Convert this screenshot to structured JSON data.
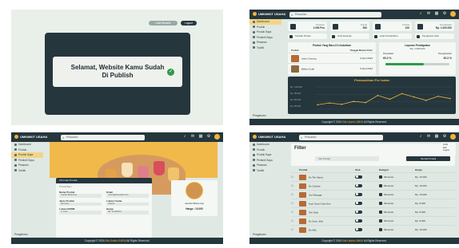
{
  "publish": {
    "pill_preview": "Lihat Website",
    "pill_action": "Logout",
    "message": "Selamat, Website Kamu Sudah Di Publish",
    "icons": [
      "check-circle-icon"
    ]
  },
  "app": {
    "brand": "UMKMKIT USAHA",
    "search_placeholder": "Pencarian",
    "footer_prefix": "Copyright © 2024",
    "footer_brand": "Kita Usaha UMKM",
    "footer_suffix": "All Rights Reserved.",
    "sidebar": [
      "Dashboard",
      "Produk",
      "Produk Saya",
      "Pembeli Saya",
      "Pesanan",
      "Toolkit"
    ],
    "sidebar_bottom": "Pengaturan"
  },
  "dashboard": {
    "stats": [
      {
        "label": "Pesanan",
        "value": "1.000 Pcs"
      },
      {
        "label": "Terjual",
        "value": "500"
      },
      {
        "label": "Produk",
        "value": "100"
      },
      {
        "label": "Pendapatan",
        "value": "Rp. 1.000.000"
      }
    ],
    "chips": [
      "Tambah Produk",
      "Lihat Pesanan",
      "Lihat Produk Baru",
      "Pengaturan Toko"
    ],
    "table_title": "Produk Yang Baru Di Unduhkan",
    "table_headers": [
      "Produk",
      "Tanggal Masuk Order"
    ],
    "table_rows": [
      {
        "name": "Ayam Goreng",
        "date": "6 April 2024"
      },
      {
        "name": "Bakso Kuah",
        "date": "5 April 2024"
      }
    ],
    "target_title": "Laporan Pendapatan",
    "target_value": "Rp. 1.000.000",
    "target_labels": [
      "Penjualan",
      "Pengeluaran"
    ],
    "target_pcts": [
      "60.2 %",
      "20.3 %"
    ],
    "chart_title": "Pemasukkan Per bulan",
    "chart_ylabels": [
      "Rp. 1.000.000",
      "Rp. 750.000",
      "Rp. 500.000",
      "Rp. 250.000"
    ],
    "chart_data": {
      "type": "line",
      "title": "Pemasukkan Per bulan",
      "x": [
        1,
        2,
        3,
        4,
        5,
        6,
        7,
        8,
        9,
        10,
        11,
        12
      ],
      "series": [
        {
          "values": [
            20,
            28,
            22,
            35,
            30,
            62,
            45,
            70,
            55,
            40,
            58,
            48
          ]
        }
      ],
      "ylim": [
        0,
        100
      ]
    }
  },
  "detail": {
    "form_title": "Informasi Produk",
    "form_sub": "Produk Baru",
    "fields": [
      {
        "label": "Nama Produk",
        "value": "Jual Es Boba Cup"
      },
      {
        "label": "Email",
        "value": "umkm@kitausaha.com"
      },
      {
        "label": "Jenis Produk",
        "value": "Minuman"
      },
      {
        "label": "Lokasi Usaha",
        "value": "Jakarta"
      },
      {
        "label": "Lokasi KDNM",
        "value": "1-4 hari"
      },
      {
        "label": "Harga",
        "value": "Rp. 10.000/Pcs"
      }
    ],
    "card_name": "Jual Es Boba Cup",
    "card_price": "Harga : 10.000"
  },
  "products": {
    "filter_title": "Filter",
    "filter_placeholder": "Cari Produk",
    "filter_button": "Tambah Produk",
    "menu_items": [
      "Profil",
      "Edit",
      "Logout"
    ],
    "headers": [
      "Produk",
      "Stok",
      "Kategori",
      "Harga"
    ],
    "rows": [
      {
        "name": "Es Teh Manis",
        "category": "Minuman",
        "price": "Rp. 10.000"
      },
      {
        "name": "Es Cokelat",
        "category": "Minuman",
        "price": "Rp. 10.000"
      },
      {
        "name": "Jus Mangga",
        "category": "Minuman",
        "price": "Rp. 10.000"
      },
      {
        "name": "Kopi Susu Gula Aren",
        "category": "Minuman",
        "price": "Rp. 8.000"
      },
      {
        "name": "Teh Tarik",
        "category": "Minuman",
        "price": "Rp. 8.000"
      },
      {
        "name": "Es Susu Jelly",
        "category": "Minuman",
        "price": "Rp. 8.000"
      },
      {
        "name": "Es Milo",
        "category": "Minuman",
        "price": "Rp. 10.000"
      }
    ]
  }
}
